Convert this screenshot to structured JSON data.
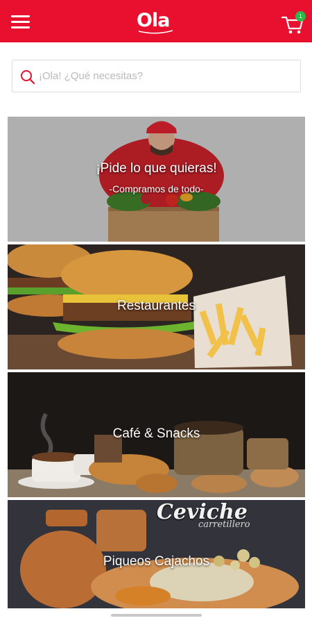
{
  "header": {
    "logo_text": "Ola",
    "cart_count": "1",
    "brand_color": "#e8102e",
    "badge_color": "#2db84a",
    "icons": [
      "hamburger-menu-icon",
      "cart-icon"
    ]
  },
  "search": {
    "placeholder": "¡Ola! ¿Qué necesitas?",
    "icon": "search-icon"
  },
  "categories": [
    {
      "label": "¡Pide lo que quieras!",
      "subtitle": "-Compramos de todo-"
    },
    {
      "label": "Restaurantes"
    },
    {
      "label": "Café & Snacks"
    },
    {
      "label": "Piqueos Cajachos",
      "sign_text": "Ceviche",
      "sign_subtext": "carretillero"
    }
  ]
}
